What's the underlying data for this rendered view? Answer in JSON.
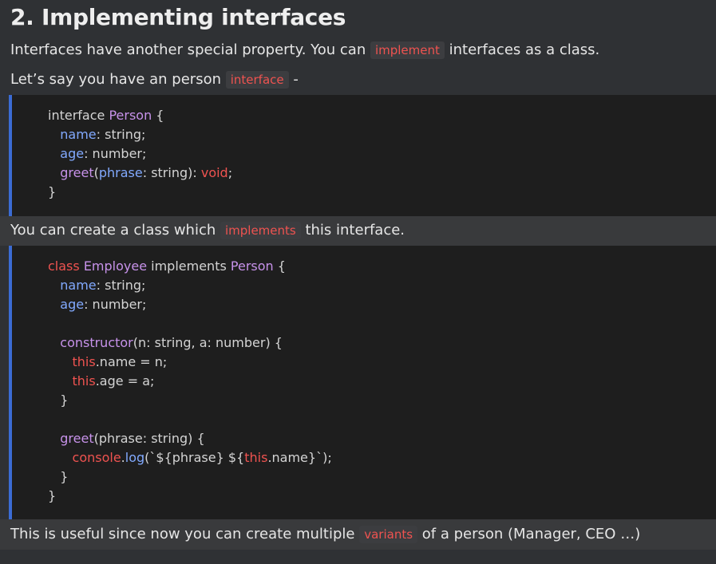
{
  "heading": "2. Implementing interfaces",
  "p1": {
    "before": "Interfaces have another special property. You can ",
    "code": "implement",
    "after": " interfaces as a class."
  },
  "p2": {
    "before": "Let’s say you have an person ",
    "code": "interface",
    "after": " -"
  },
  "p3": {
    "before": "You can create a class which ",
    "code": "implements",
    "after": " this interface."
  },
  "p4": {
    "before": "This is useful since now you can create multiple ",
    "code": "variants",
    "after": " of a person (Manager, CEO …)"
  },
  "code1": {
    "l1_kw": "interface",
    "l1_name": "Person",
    "l1_brace": " {",
    "l2_prop": "name",
    "l2_rest": ": string;",
    "l3_prop": "age",
    "l3_rest": ": number;",
    "l4_fn": "greet",
    "l4_paren_open": "(",
    "l4_param": "phrase",
    "l4_mid": ": string): ",
    "l4_type": "void",
    "l4_end": ";",
    "l5": "}"
  },
  "code2": {
    "l1_kw": "class",
    "l1_name": "Employee",
    "l1_impl": " implements ",
    "l1_iface": "Person",
    "l1_brace": " {",
    "l2_prop": "name",
    "l2_rest": ": string;",
    "l3_prop": "age",
    "l3_rest": ": number;",
    "l5_fn": "constructor",
    "l5_rest": "(n: string, a: number) {",
    "l6_this": "this",
    "l6_rest": ".name = n;",
    "l7_this": "this",
    "l7_rest": ".age = a;",
    "l8": "}",
    "l10_fn": "greet",
    "l10_rest": "(phrase: string) {",
    "l11_console": "console",
    "l11_dot": ".",
    "l11_log": "log",
    "l11_a": "(`${phrase} ${",
    "l11_this": "this",
    "l11_b": ".name}`);",
    "l12": "}",
    "l13": "}"
  }
}
